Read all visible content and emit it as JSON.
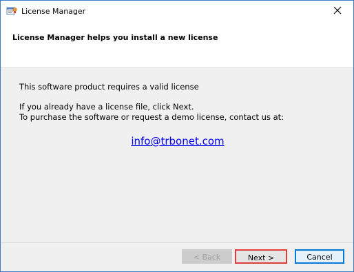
{
  "window": {
    "title": "License Manager",
    "accent_color": "#3c7ac4"
  },
  "header": {
    "title": "License Manager helps you install a new license"
  },
  "body": {
    "line1": "This software product requires a valid license",
    "line2": "If you already have a license file, click Next.",
    "line3": "To purchase the software or request a demo license, contact us at:",
    "email": "info@trbonet.com"
  },
  "buttons": {
    "back": "< Back",
    "next": "Next >",
    "cancel": "Cancel"
  },
  "icons": {
    "app": "license-app-icon",
    "close": "close-icon"
  }
}
